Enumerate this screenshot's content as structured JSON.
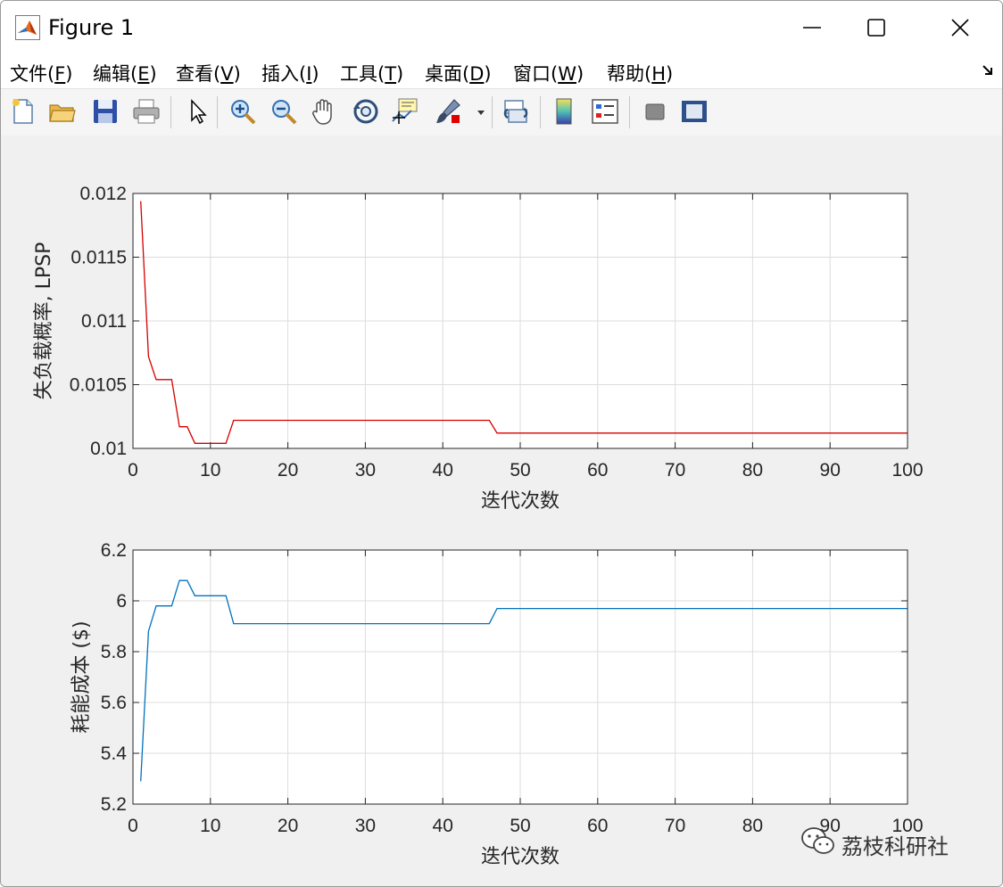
{
  "window": {
    "title": "Figure 1"
  },
  "menu": [
    {
      "label": "文件(F)",
      "key": "F"
    },
    {
      "label": "编辑(E)",
      "key": "E"
    },
    {
      "label": "查看(V)",
      "key": "V"
    },
    {
      "label": "插入(I)",
      "key": "I"
    },
    {
      "label": "工具(T)",
      "key": "T"
    },
    {
      "label": "桌面(D)",
      "key": "D"
    },
    {
      "label": "窗口(W)",
      "key": "W"
    },
    {
      "label": "帮助(H)",
      "key": "H"
    }
  ],
  "toolbar": [
    "new-figure-icon",
    "open-file-icon",
    "save-icon",
    "print-icon",
    "pointer-icon",
    "zoom-in-icon",
    "zoom-out-icon",
    "pan-hand-icon",
    "rotate-3d-icon",
    "data-cursor-icon",
    "brush-icon",
    "brush-dropdown-icon",
    "link-plot-icon",
    "colorbar-icon",
    "legend-icon",
    "hide-plot-tools-icon",
    "show-plot-tools-icon"
  ],
  "watermark": {
    "text": "荔枝科研社"
  },
  "chart_data": [
    {
      "type": "line",
      "xlabel": "迭代次数",
      "ylabel": "失负载概率, LPSP",
      "xlim": [
        0,
        100
      ],
      "ylim": [
        0.01,
        0.012
      ],
      "xticks": [
        "0",
        "10",
        "20",
        "30",
        "40",
        "50",
        "60",
        "70",
        "80",
        "90",
        "100"
      ],
      "yticks": [
        "0.01",
        "0.0105",
        "0.011",
        "0.0115",
        "0.012"
      ],
      "grid": true,
      "series": [
        {
          "color": "#d40000",
          "x": [
            1,
            2,
            3,
            4,
            5,
            6,
            7,
            8,
            9,
            10,
            11,
            12,
            13,
            14,
            20,
            30,
            40,
            46,
            47,
            50,
            60,
            70,
            80,
            90,
            100
          ],
          "y": [
            0.01194,
            0.01072,
            0.01054,
            0.01054,
            0.01054,
            0.01017,
            0.01017,
            0.01004,
            0.01004,
            0.01004,
            0.01004,
            0.01004,
            0.01022,
            0.01022,
            0.01022,
            0.01022,
            0.01022,
            0.01022,
            0.01012,
            0.01012,
            0.01012,
            0.01012,
            0.01012,
            0.01012,
            0.01012
          ]
        }
      ]
    },
    {
      "type": "line",
      "xlabel": "迭代次数",
      "ylabel": "耗能成本 ($)",
      "xlim": [
        0,
        100
      ],
      "ylim": [
        5.2,
        6.2
      ],
      "xticks": [
        "0",
        "10",
        "20",
        "30",
        "40",
        "50",
        "60",
        "70",
        "80",
        "90",
        "100"
      ],
      "yticks": [
        "5.2",
        "5.4",
        "5.6",
        "5.8",
        "6",
        "6.2"
      ],
      "grid": true,
      "series": [
        {
          "color": "#0072bd",
          "x": [
            1,
            2,
            3,
            4,
            5,
            6,
            7,
            8,
            9,
            10,
            11,
            12,
            13,
            14,
            20,
            30,
            40,
            46,
            47,
            50,
            60,
            70,
            80,
            90,
            100
          ],
          "y": [
            5.29,
            5.88,
            5.98,
            5.98,
            5.98,
            6.08,
            6.08,
            6.02,
            6.02,
            6.02,
            6.02,
            6.02,
            5.91,
            5.91,
            5.91,
            5.91,
            5.91,
            5.91,
            5.97,
            5.97,
            5.97,
            5.97,
            5.97,
            5.97,
            5.97
          ]
        }
      ]
    }
  ]
}
